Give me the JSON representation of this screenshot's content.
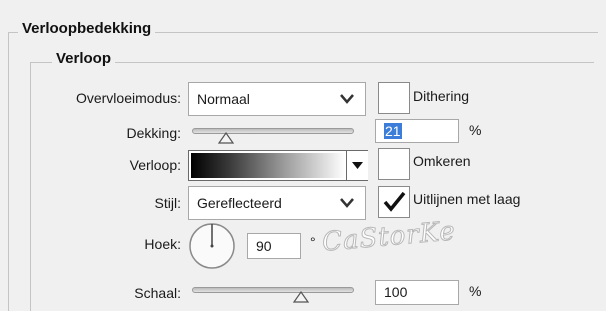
{
  "panel": {
    "title": "Verloopbedekking",
    "section_title": "Verloop"
  },
  "blend_mode": {
    "label": "Overvloeimodus:",
    "value": "Normaal"
  },
  "dither": {
    "label": "Dithering",
    "checked": false
  },
  "opacity": {
    "label": "Dekking:",
    "value": "21",
    "unit": "%",
    "level": 0.21
  },
  "gradient": {
    "label": "Verloop:",
    "reverse_label": "Omkeren",
    "reverse_checked": false
  },
  "style": {
    "label": "Stijl:",
    "value": "Gereflecteerd",
    "align_label": "Uitlijnen met laag",
    "align_checked": true
  },
  "angle": {
    "label": "Hoek:",
    "value": "90",
    "unit": "°"
  },
  "scale": {
    "label": "Schaal:",
    "value": "100",
    "unit": "%",
    "level": 0.67
  },
  "watermark": {
    "text": "CaStorKe"
  },
  "icons": [
    "chevron-down-icon",
    "dropdown-arrow-icon",
    "checkmark-icon",
    "angle-dial-icon"
  ]
}
